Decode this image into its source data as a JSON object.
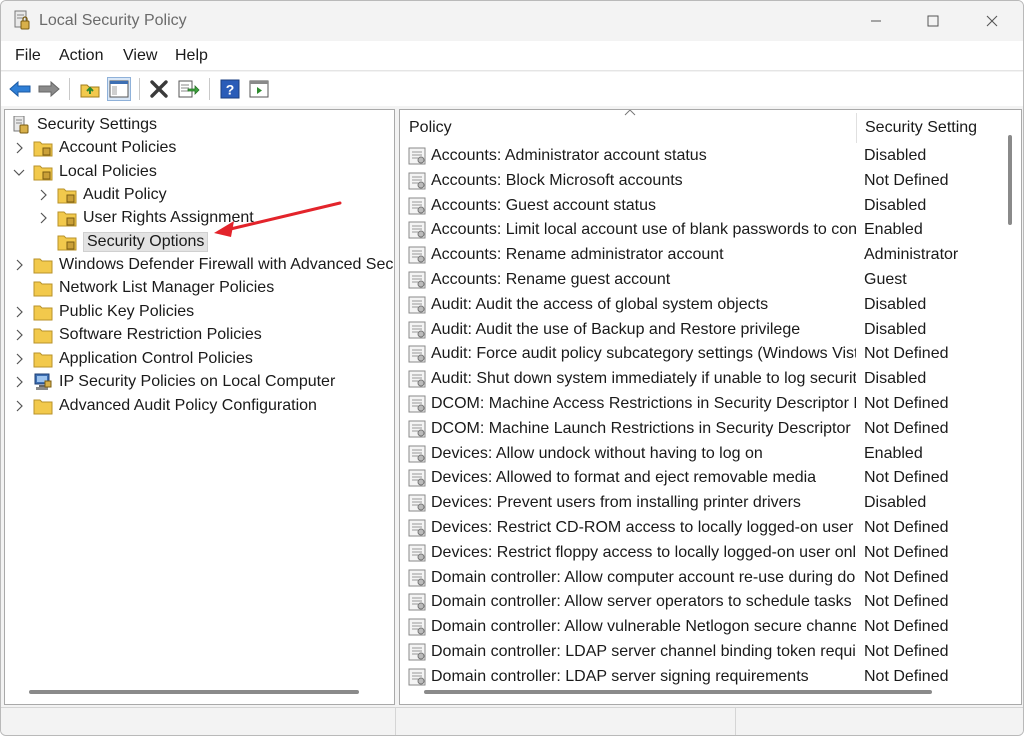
{
  "window": {
    "title": "Local Security Policy"
  },
  "menu": {
    "file": "File",
    "action": "Action",
    "view": "View",
    "help": "Help"
  },
  "toolbar": {
    "icons": [
      "back-arrow-icon",
      "forward-arrow-icon",
      "up-folder-icon",
      "show-hide-tree-icon",
      "delete-icon",
      "export-list-icon",
      "help-icon",
      "properties-icon"
    ]
  },
  "tree": {
    "root": "Security Settings",
    "account_policies": "Account Policies",
    "local_policies": "Local Policies",
    "audit_policy": "Audit Policy",
    "user_rights": "User Rights Assignment",
    "security_options": "Security Options",
    "firewall": "Windows Defender Firewall with Advanced Securi",
    "network_list": "Network List Manager Policies",
    "public_key": "Public Key Policies",
    "software_restriction": "Software Restriction Policies",
    "app_control": "Application Control Policies",
    "ip_security": "IP Security Policies on Local Computer",
    "advanced_audit": "Advanced Audit Policy Configuration"
  },
  "list": {
    "col_policy": "Policy",
    "col_setting": "Security Setting",
    "rows": [
      {
        "policy": "Accounts: Administrator account status",
        "setting": "Disabled"
      },
      {
        "policy": "Accounts: Block Microsoft accounts",
        "setting": "Not Defined"
      },
      {
        "policy": "Accounts: Guest account status",
        "setting": "Disabled"
      },
      {
        "policy": "Accounts: Limit local account use of blank passwords to cons...",
        "setting": "Enabled"
      },
      {
        "policy": "Accounts: Rename administrator account",
        "setting": "Administrator"
      },
      {
        "policy": "Accounts: Rename guest account",
        "setting": "Guest"
      },
      {
        "policy": "Audit: Audit the access of global system objects",
        "setting": "Disabled"
      },
      {
        "policy": "Audit: Audit the use of Backup and Restore privilege",
        "setting": "Disabled"
      },
      {
        "policy": "Audit: Force audit policy subcategory settings (Windows Vista...",
        "setting": "Not Defined"
      },
      {
        "policy": "Audit: Shut down system immediately if unable to log securit...",
        "setting": "Disabled"
      },
      {
        "policy": "DCOM: Machine Access Restrictions in Security Descriptor Def...",
        "setting": "Not Defined"
      },
      {
        "policy": "DCOM: Machine Launch Restrictions in Security Descriptor De...",
        "setting": "Not Defined"
      },
      {
        "policy": "Devices: Allow undock without having to log on",
        "setting": "Enabled"
      },
      {
        "policy": "Devices: Allowed to format and eject removable media",
        "setting": "Not Defined"
      },
      {
        "policy": "Devices: Prevent users from installing printer drivers",
        "setting": "Disabled"
      },
      {
        "policy": "Devices: Restrict CD-ROM access to locally logged-on user on...",
        "setting": "Not Defined"
      },
      {
        "policy": "Devices: Restrict floppy access to locally logged-on user only",
        "setting": "Not Defined"
      },
      {
        "policy": "Domain controller: Allow computer account re-use during do...",
        "setting": "Not Defined"
      },
      {
        "policy": "Domain controller: Allow server operators to schedule tasks",
        "setting": "Not Defined"
      },
      {
        "policy": "Domain controller: Allow vulnerable Netlogon secure channel...",
        "setting": "Not Defined"
      },
      {
        "policy": "Domain controller: LDAP server channel binding token requir...",
        "setting": "Not Defined"
      },
      {
        "policy": "Domain controller: LDAP server signing requirements",
        "setting": "Not Defined"
      }
    ]
  },
  "colors": {
    "accent": "#e3242b",
    "folder": "#f2c94c",
    "selection": "#e3e3e3"
  }
}
